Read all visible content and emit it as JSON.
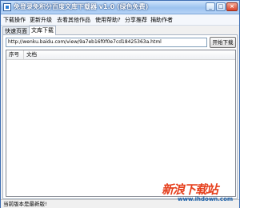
{
  "window": {
    "title": "免登录免积分百度文库下载器 v1.0 (绿色免费)",
    "controls": {
      "minimize": "_",
      "maximize": "□",
      "close": "×"
    }
  },
  "menu": {
    "items": [
      {
        "label": "下载操作"
      },
      {
        "label": "更新升级"
      },
      {
        "label": "去看其他作品"
      },
      {
        "label": "使用帮助?"
      },
      {
        "label": "分享推荐"
      },
      {
        "label": "捐助作者"
      }
    ]
  },
  "tabs": [
    {
      "label": "快速页面",
      "active": false
    },
    {
      "label": "文库下载",
      "active": true
    }
  ],
  "url_input": {
    "value": "http://wenku.baidu.com/view/9a7eb16f0f0e7cd18425363a.html"
  },
  "start_button": {
    "label": "开始下载"
  },
  "table": {
    "columns": [
      "序号",
      "文档"
    ],
    "rows": []
  },
  "status": {
    "text": "当前版本是最新版!"
  },
  "watermark": {
    "logo": "新浪下载站",
    "url": "www.ihdown.com"
  },
  "colors": {
    "titlebar": "#9bc2ef",
    "window_border": "#3f6fb3",
    "watermark_red": "#e6401d",
    "watermark_blue": "#2a7fc8"
  },
  "icons": [
    "app-icon",
    "minimize-icon",
    "maximize-icon",
    "close-icon"
  ]
}
